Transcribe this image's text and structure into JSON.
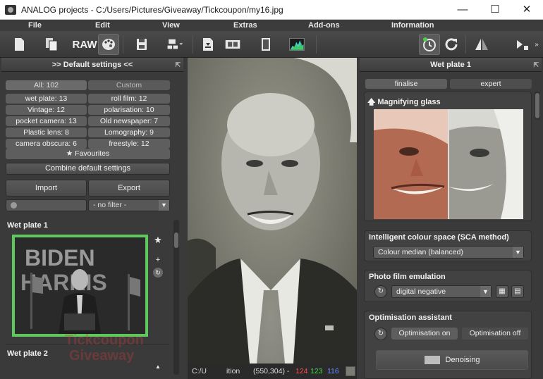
{
  "window": {
    "title": "ANALOG projects  -  C:/Users/Pictures/Giveaway/Tickcoupon/my16.jpg",
    "minimize": "—",
    "maximize": "☐",
    "close": "✕"
  },
  "menu": [
    "File",
    "Edit",
    "View",
    "Extras",
    "Add-ons",
    "Information"
  ],
  "toolbar": {
    "raw_label": "RAW"
  },
  "left_panel": {
    "header": ">> Default settings <<",
    "pin": "⇱",
    "categories": [
      {
        "label": "All: 102"
      },
      {
        "label": "Custom"
      },
      {
        "label": "wet plate: 13"
      },
      {
        "label": "roll film: 12"
      },
      {
        "label": "Vintage: 12"
      },
      {
        "label": "polarisation: 10"
      },
      {
        "label": "pocket camera: 13"
      },
      {
        "label": "Old newspaper: 7"
      },
      {
        "label": "Plastic lens: 8"
      },
      {
        "label": "Lomography: 9"
      },
      {
        "label": "camera obscura: 6"
      },
      {
        "label": "freestyle: 12"
      }
    ],
    "favourites": "Favourites",
    "combine": "Combine default settings",
    "import": "Import",
    "export": "Export",
    "filter_value": "- no filter -",
    "preset1_title": "Wet plate 1",
    "preset2_title": "Wet plate 2",
    "thumb_text_line1": "BIDEN",
    "thumb_text_line2": "HARRIS"
  },
  "watermark": {
    "line1": "Tickcoupon",
    "line2": "Giveaway"
  },
  "status": {
    "path": "C:/U",
    "label": "ition",
    "coords": "(550,304) -",
    "r": "124",
    "g": "123",
    "b": "116",
    "colors": {
      "r": "#ff4d4d",
      "g": "#3fdc3f",
      "b": "#6b8cff"
    }
  },
  "right_panel": {
    "header": "Wet plate 1",
    "tab_finalise": "finalise",
    "tab_expert": "expert",
    "magnifier_title": "Magnifying glass",
    "sca_title": "Intelligent colour space (SCA method)",
    "sca_value": "Colour median (balanced)",
    "film_title": "Photo film emulation",
    "film_value": "digital negative",
    "opt_title": "Optimisation assistant",
    "opt_on": "Optimisation on",
    "opt_off": "Optimisation off",
    "denoising": "Denoising"
  }
}
